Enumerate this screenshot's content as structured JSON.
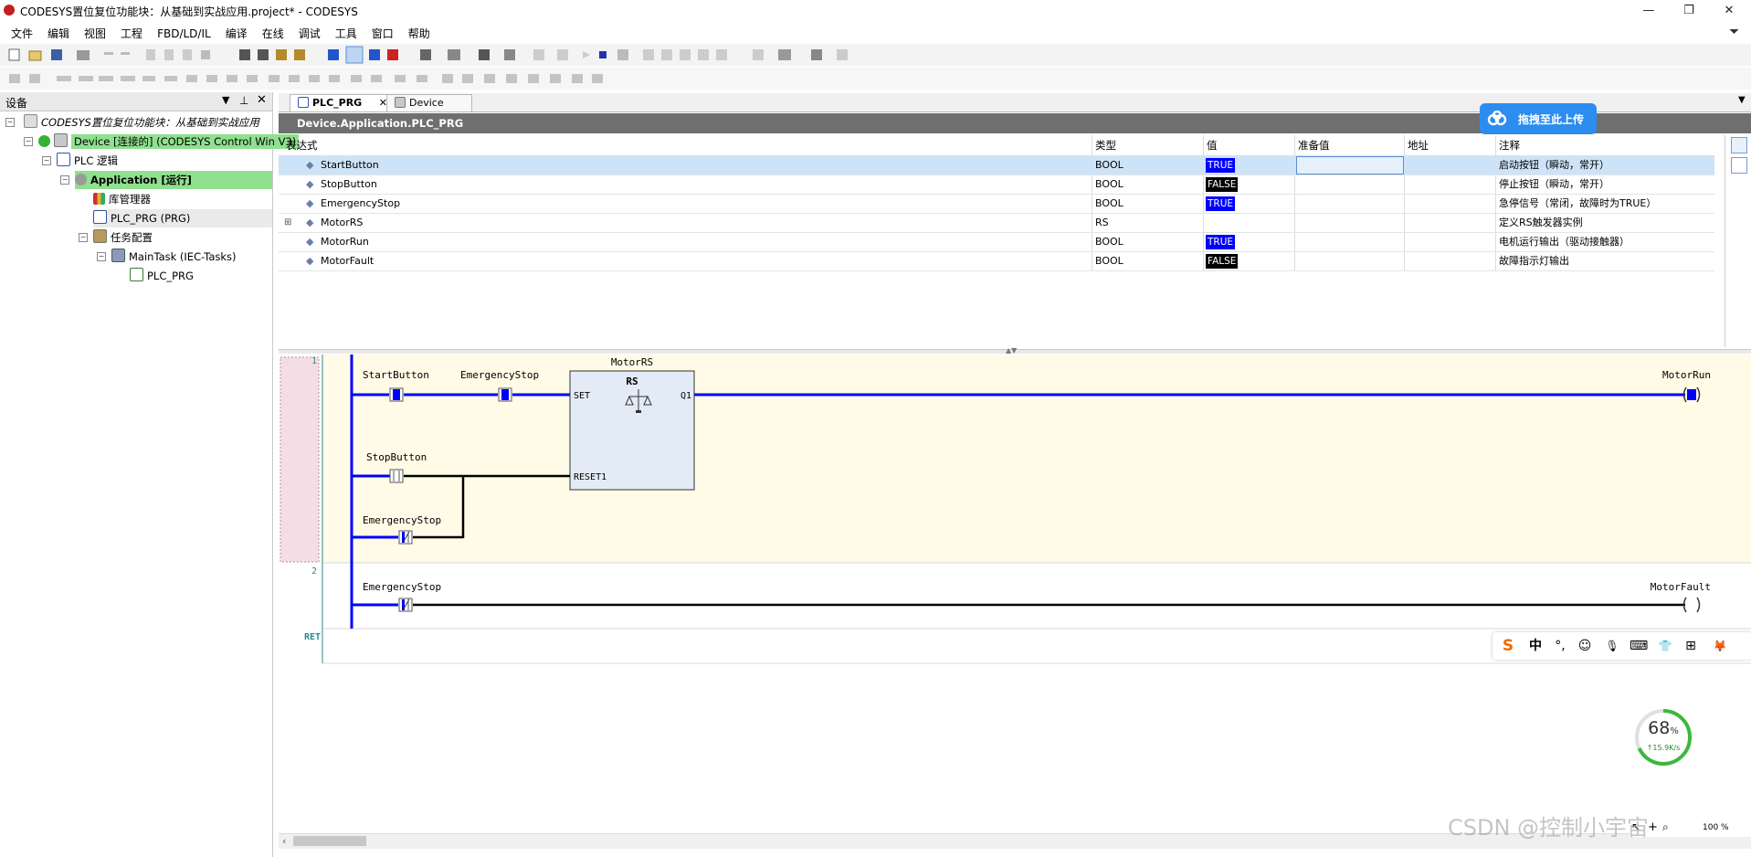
{
  "window": {
    "title": "CODESYS置位复位功能块：从基础到实战应用.project* - CODESYS",
    "minimize": "—",
    "restore": "❐",
    "close": "✕"
  },
  "menu": [
    "文件",
    "编辑",
    "视图",
    "工程",
    "FBD/LD/IL",
    "编译",
    "在线",
    "调试",
    "工具",
    "窗口",
    "帮助"
  ],
  "devices_pane": {
    "header": "设备",
    "tree": [
      {
        "label": "CODESYS置位复位功能块：从基础到实战应用",
        "italic": true
      },
      {
        "label": "Device [连接的] (CODESYS Control Win V3)",
        "highlight": "#8fe08f"
      },
      {
        "label": "PLC 逻辑"
      },
      {
        "label": "Application [运行]",
        "highlight": "#8fe08f",
        "bold": true
      },
      {
        "label": "库管理器"
      },
      {
        "label": "PLC_PRG (PRG)",
        "selected": true
      },
      {
        "label": "任务配置"
      },
      {
        "label": "MainTask (IEC-Tasks)"
      },
      {
        "label": "PLC_PRG"
      }
    ]
  },
  "tabs": [
    {
      "label": "PLC_PRG",
      "active": true,
      "close": "✕"
    },
    {
      "label": "Device",
      "active": false
    }
  ],
  "path": "Device.Application.PLC_PRG",
  "upload_button": "拖拽至此上传",
  "variables": {
    "columns": [
      "表达式",
      "类型",
      "值",
      "准备值",
      "地址",
      "注释"
    ],
    "rows": [
      {
        "expr": "StartButton",
        "type": "BOOL",
        "value": "TRUE",
        "value_color": "#0000ff",
        "comment": "启动按钮（瞬动，常开）",
        "selected": true
      },
      {
        "expr": "StopButton",
        "type": "BOOL",
        "value": "FALSE",
        "value_color": "#000000",
        "comment": "停止按钮（瞬动，常开）"
      },
      {
        "expr": "EmergencyStop",
        "type": "BOOL",
        "value": "TRUE",
        "value_color": "#0000ff",
        "comment": "急停信号（常闭，故障时为TRUE）"
      },
      {
        "expr": "MotorRS",
        "type": "RS",
        "value": "",
        "value_color": "",
        "comment": "定义RS触发器实例",
        "expandable": true
      },
      {
        "expr": "MotorRun",
        "type": "BOOL",
        "value": "TRUE",
        "value_color": "#0000ff",
        "comment": "电机运行输出（驱动接触器）"
      },
      {
        "expr": "MotorFault",
        "type": "BOOL",
        "value": "FALSE",
        "value_color": "#000000",
        "comment": "故障指示灯输出"
      }
    ]
  },
  "ladder": {
    "networks": [
      {
        "number": "1",
        "contacts": [
          "StartButton",
          "EmergencyStop",
          "StopButton",
          "EmergencyStop"
        ],
        "fb_instance": "MotorRS",
        "fb_type": "RS",
        "fb_inputs": [
          "SET",
          "RESET1"
        ],
        "fb_output": "Q1",
        "coil": "MotorRun"
      },
      {
        "number": "2",
        "contacts": [
          "EmergencyStop"
        ],
        "coil": "MotorFault"
      }
    ],
    "ret_label": "RET"
  },
  "network_monitor": {
    "percent": "68",
    "unit": "%",
    "speed": "↑15.9K/s"
  },
  "ime_bar": [
    "S",
    "中",
    "°,",
    "☺",
    "🎙",
    "⌨",
    "👕",
    "⊞",
    "🦊"
  ],
  "zoom": "100 %",
  "watermark": "CSDN @控制小宇宙",
  "colors": {
    "live_wire": "#0000ff",
    "off_wire": "#000000",
    "network_bg": "#fffbe6",
    "fb_fill": "#e3ebf7",
    "selection": "#cde3f7"
  }
}
